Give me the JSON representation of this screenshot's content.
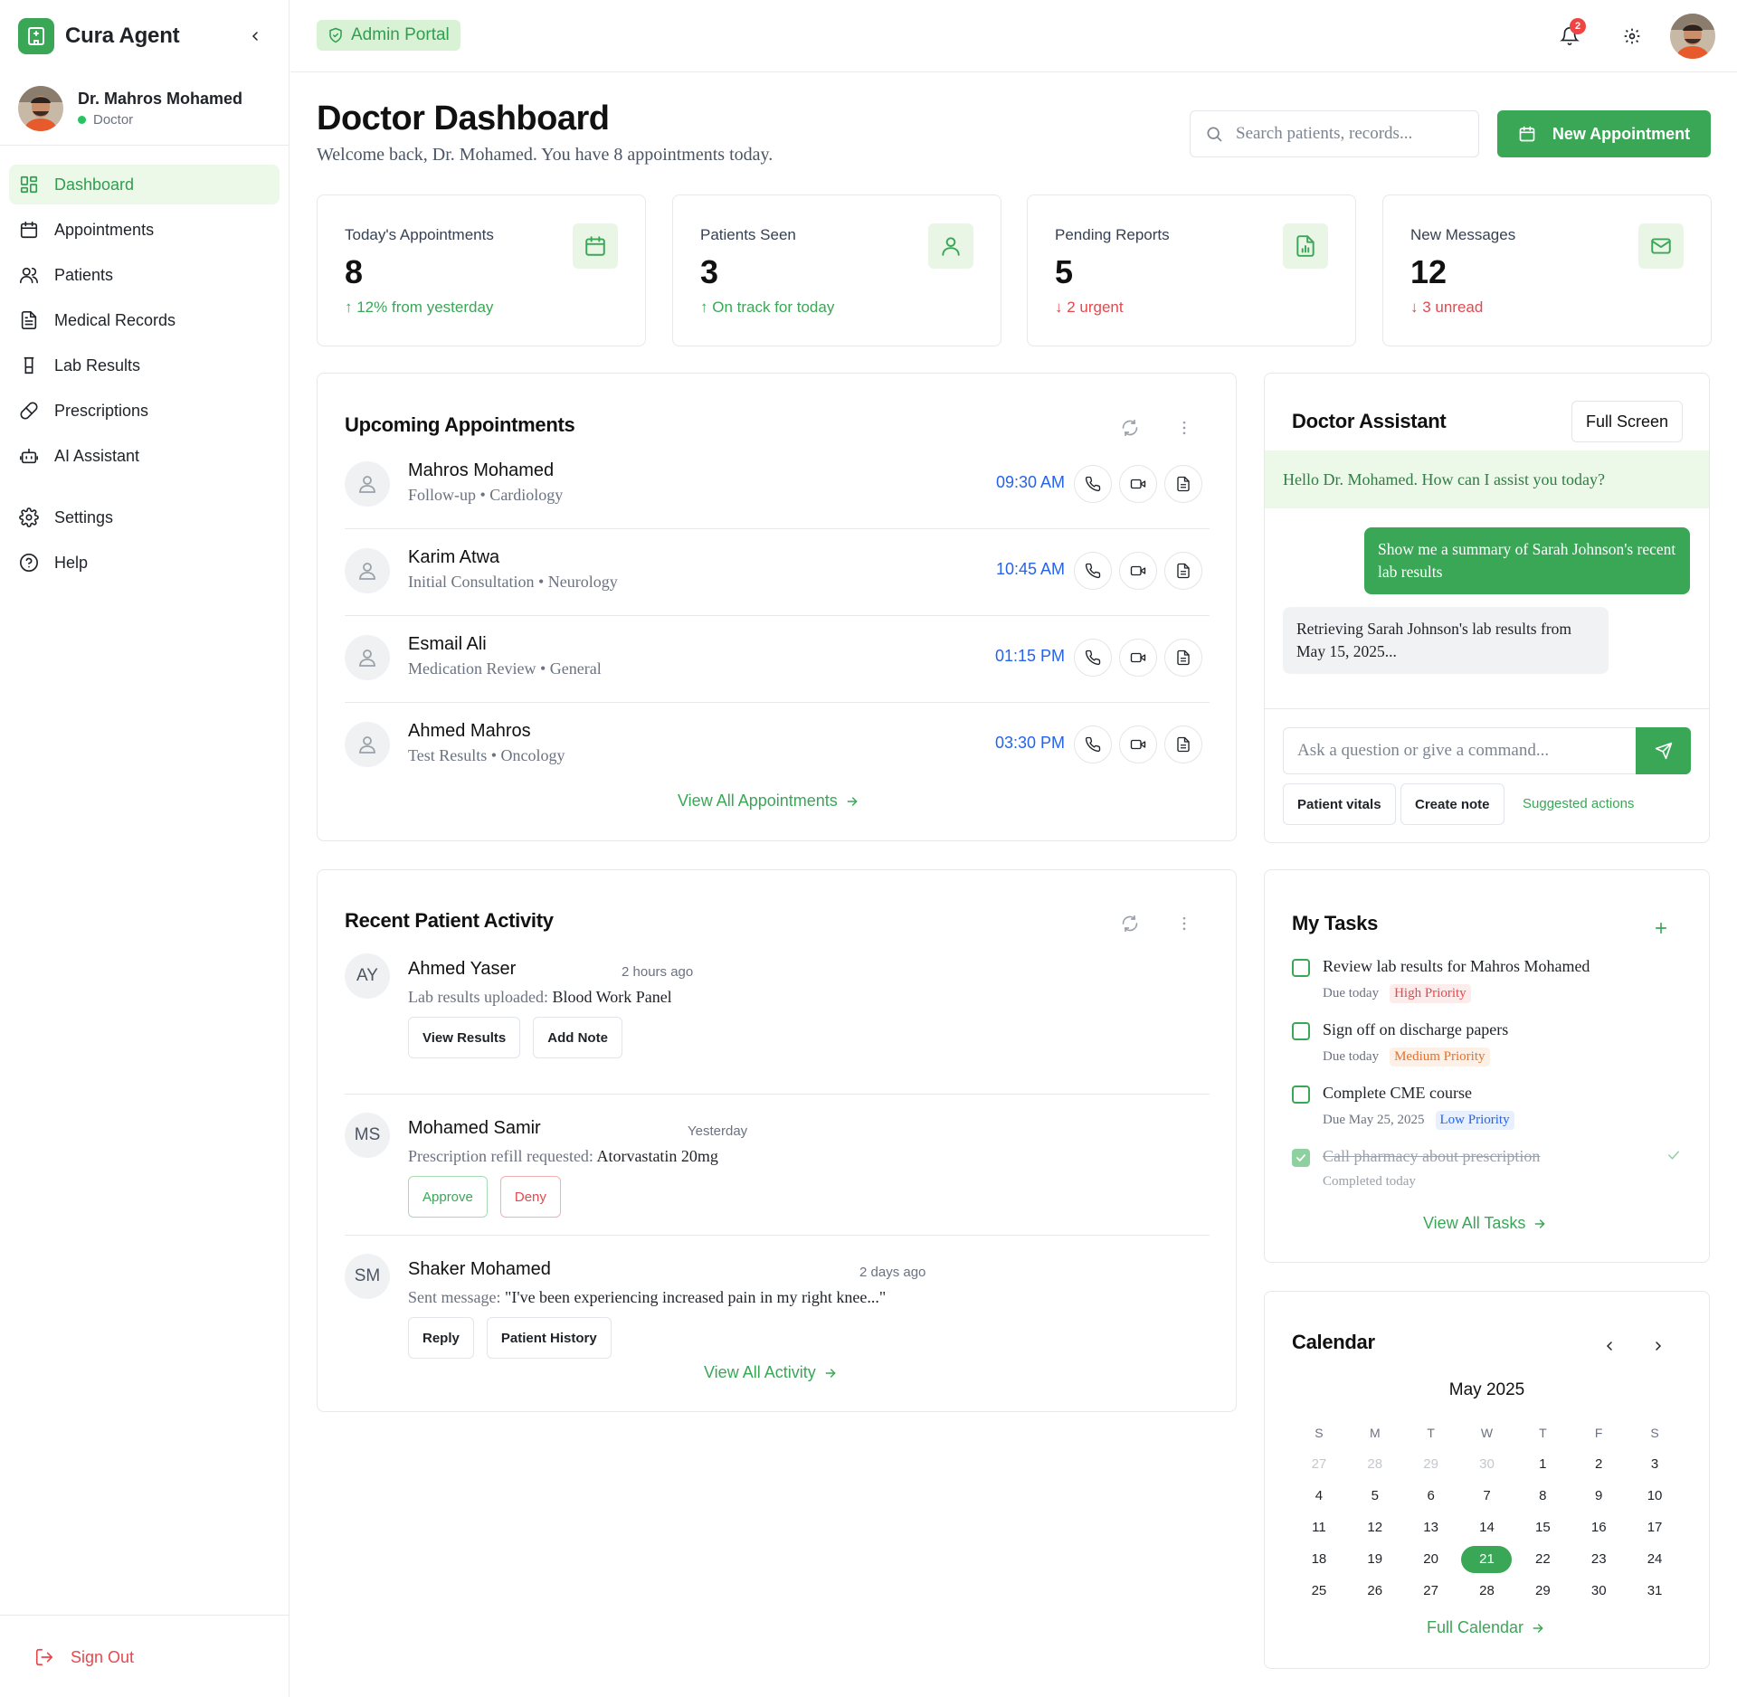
{
  "app": {
    "name": "Cura Agent",
    "portal_badge": "Admin Portal",
    "notification_count": "2"
  },
  "profile": {
    "name": "Dr. Mahros Mohamed",
    "role": "Doctor",
    "status_color": "#22c55e"
  },
  "sidebar": {
    "items": [
      {
        "label": "Dashboard",
        "icon": "dashboard-icon",
        "active": true
      },
      {
        "label": "Appointments",
        "icon": "calendar-icon"
      },
      {
        "label": "Patients",
        "icon": "users-icon"
      },
      {
        "label": "Medical Records",
        "icon": "file-text-icon"
      },
      {
        "label": "Lab Results",
        "icon": "flask-icon"
      },
      {
        "label": "Prescriptions",
        "icon": "pill-icon"
      },
      {
        "label": "AI Assistant",
        "icon": "bot-icon"
      }
    ],
    "footer_items": [
      {
        "label": "Settings",
        "icon": "gear-icon"
      },
      {
        "label": "Help",
        "icon": "help-circle-icon"
      }
    ],
    "sign_out": "Sign Out"
  },
  "header": {
    "title": "Doctor Dashboard",
    "subtitle": "Welcome back, Dr. Mohamed. You have 8 appointments today.",
    "search_placeholder": "Search patients, records...",
    "new_appointment": "New Appointment"
  },
  "stats": [
    {
      "label": "Today's Appointments",
      "value": "8",
      "trend": "↑ 12% from yesterday",
      "trend_dir": "up",
      "icon": "calendar-icon"
    },
    {
      "label": "Patients Seen",
      "value": "3",
      "trend": "↑ On track for today",
      "trend_dir": "up",
      "icon": "user-icon"
    },
    {
      "label": "Pending Reports",
      "value": "5",
      "trend": "↓ 2 urgent",
      "trend_dir": "down",
      "icon": "report-icon"
    },
    {
      "label": "New Messages",
      "value": "12",
      "trend": "↓ 3 unread",
      "trend_dir": "down",
      "icon": "mail-icon"
    }
  ],
  "appointments": {
    "title": "Upcoming Appointments",
    "items": [
      {
        "name": "Mahros Mohamed",
        "detail": "Follow-up • Cardiology",
        "time": "09:30 AM"
      },
      {
        "name": "Karim Atwa",
        "detail": "Initial Consultation • Neurology",
        "time": "10:45 AM"
      },
      {
        "name": "Esmail Ali",
        "detail": "Medication Review • General",
        "time": "01:15 PM"
      },
      {
        "name": "Ahmed Mahros",
        "detail": "Test Results • Oncology",
        "time": "03:30 PM"
      }
    ],
    "view_all": "View All Appointments"
  },
  "activity": {
    "title": "Recent Patient Activity",
    "items": [
      {
        "initials": "AY",
        "name": "Ahmed Yaser",
        "time": "2 hours ago",
        "desc_prefix": "Lab results uploaded: ",
        "desc_value": "Blood Work Panel",
        "buttons": [
          "View Results",
          "Add Note"
        ]
      },
      {
        "initials": "MS",
        "name": "Mohamed Samir",
        "time": "Yesterday",
        "desc_prefix": "Prescription refill requested: ",
        "desc_value": "Atorvastatin 20mg",
        "buttons": [
          "Approve",
          "Deny"
        ]
      },
      {
        "initials": "SM",
        "name": "Shaker Mohamed",
        "time": "2 days ago",
        "desc_prefix": "Sent message: ",
        "desc_value": "\"I've been experiencing increased pain in my right knee...\"",
        "buttons": [
          "Reply",
          "Patient History"
        ]
      }
    ],
    "view_all": "View All Activity"
  },
  "assistant": {
    "title": "Doctor Assistant",
    "full_screen": "Full Screen",
    "greeting": "Hello Dr. Mohamed. How can I assist you today?",
    "user_message": "Show me a summary of Sarah Johnson's recent lab results",
    "bot_message": "Retrieving Sarah Johnson's lab results from May 15, 2025...",
    "input_placeholder": "Ask a question or give a command...",
    "chips": [
      "Patient vitals",
      "Create note"
    ],
    "suggested": "Suggested actions"
  },
  "tasks": {
    "title": "My Tasks",
    "items": [
      {
        "title": "Review lab results for Mahros Mohamed",
        "due": "Due today",
        "priority": "High Priority",
        "level": "high",
        "done": false
      },
      {
        "title": "Sign off on discharge papers",
        "due": "Due today",
        "priority": "Medium Priority",
        "level": "med",
        "done": false
      },
      {
        "title": "Complete CME course",
        "due": "Due May 25, 2025",
        "priority": "Low Priority",
        "level": "low",
        "done": false
      },
      {
        "title": "Call pharmacy about prescription",
        "due": "Completed today",
        "priority": "",
        "level": "",
        "done": true
      }
    ],
    "view_all": "View All Tasks"
  },
  "calendar": {
    "title": "Calendar",
    "month": "May 2025",
    "weekdays": [
      "S",
      "M",
      "T",
      "W",
      "T",
      "F",
      "S"
    ],
    "days": [
      {
        "d": "27",
        "muted": true
      },
      {
        "d": "28",
        "muted": true
      },
      {
        "d": "29",
        "muted": true
      },
      {
        "d": "30",
        "muted": true
      },
      {
        "d": "1"
      },
      {
        "d": "2"
      },
      {
        "d": "3"
      },
      {
        "d": "4"
      },
      {
        "d": "5"
      },
      {
        "d": "6"
      },
      {
        "d": "7"
      },
      {
        "d": "8"
      },
      {
        "d": "9"
      },
      {
        "d": "10"
      },
      {
        "d": "11"
      },
      {
        "d": "12"
      },
      {
        "d": "13"
      },
      {
        "d": "14"
      },
      {
        "d": "15"
      },
      {
        "d": "16"
      },
      {
        "d": "17"
      },
      {
        "d": "18"
      },
      {
        "d": "19"
      },
      {
        "d": "20"
      },
      {
        "d": "21",
        "today": true
      },
      {
        "d": "22"
      },
      {
        "d": "23"
      },
      {
        "d": "24"
      },
      {
        "d": "25"
      },
      {
        "d": "26"
      },
      {
        "d": "27"
      },
      {
        "d": "28"
      },
      {
        "d": "29"
      },
      {
        "d": "30"
      },
      {
        "d": "31"
      }
    ],
    "full_calendar": "Full Calendar"
  },
  "colors": {
    "brand": "#3aa757",
    "link": "#2563eb",
    "danger": "#e5484d"
  }
}
